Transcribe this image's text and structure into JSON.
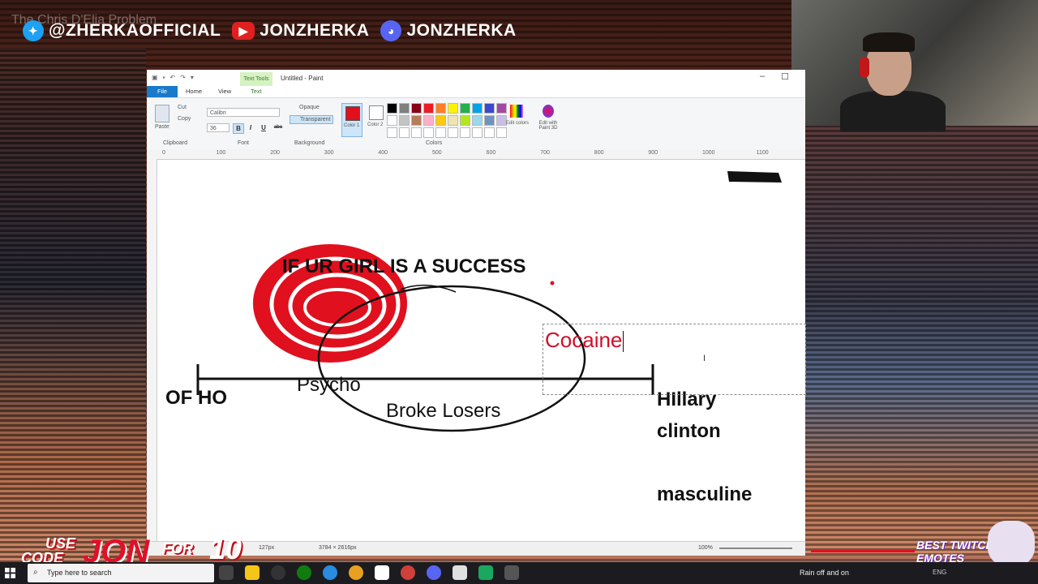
{
  "stream": {
    "faded_title": "The Chris D'Elia Problem",
    "socials": [
      {
        "icon": "twitter-icon",
        "handle": "@ZHERKAOFFICIAL"
      },
      {
        "icon": "youtube-icon",
        "handle": "JONZHERKA"
      },
      {
        "icon": "discord-icon",
        "handle": "JONZHERKA"
      }
    ],
    "promo": {
      "use": "USE",
      "code": "CODE",
      "name": "JON",
      "for": "FOR",
      "pct": "10"
    },
    "emotes_label": "BEST TWITCH EMOTES"
  },
  "paint": {
    "window_title": "Untitled - Paint",
    "context_tab": "Text Tools",
    "tabs": {
      "file": "File",
      "home": "Home",
      "view": "View",
      "text": "Text"
    },
    "ribbon": {
      "clipboard": {
        "paste": "Paste",
        "cut": "Cut",
        "copy": "Copy",
        "group": "Clipboard"
      },
      "font": {
        "family": "Calibri",
        "size": "36",
        "bold": "B",
        "italic": "I",
        "underline": "U",
        "strike": "abc",
        "group": "Font"
      },
      "background": {
        "opaque": "Opaque",
        "transparent": "Transparent",
        "group": "Background"
      },
      "colors": {
        "color1": "Color 1",
        "color2": "Color 2",
        "edit": "Edit colors",
        "group": "Colors",
        "palette": [
          "#000000",
          "#7f7f7f",
          "#880015",
          "#ed1c24",
          "#ff7f27",
          "#fff200",
          "#22b14c",
          "#00a2e8",
          "#3f48cc",
          "#a349a4",
          "#ffffff",
          "#c3c3c3",
          "#b97a57",
          "#ffaec9",
          "#ffc90e",
          "#efe4b0",
          "#b5e61d",
          "#99d9ea",
          "#7092be",
          "#c8bfe7",
          "#ffffff",
          "#ffffff",
          "#ffffff",
          "#ffffff",
          "#ffffff",
          "#ffffff",
          "#ffffff",
          "#ffffff",
          "#ffffff",
          "#ffffff"
        ]
      },
      "paint3d": "Edit with Paint 3D"
    },
    "ruler_ticks": [
      "0",
      "100",
      "200",
      "300",
      "400",
      "500",
      "600",
      "700",
      "800",
      "900",
      "1000",
      "1100"
    ],
    "canvas": {
      "heading": "IF UR GIRL IS A SUCCESS",
      "left_label": "OF  HO",
      "psycho": "Psycho",
      "broke": "Broke Losers",
      "right_label_1": "HIllary",
      "right_label_2": "clinton",
      "masculine": "masculine",
      "textbox_text": "Cocaine",
      "colors": {
        "red": "#e0101e",
        "ink": "#111111"
      }
    },
    "status": {
      "position": "127px",
      "size": "3784 × 2616px",
      "zoom": "100%"
    }
  },
  "taskbar": {
    "search_placeholder": "Type here to search",
    "weather": "Rain off and on",
    "lang": "ENG"
  }
}
